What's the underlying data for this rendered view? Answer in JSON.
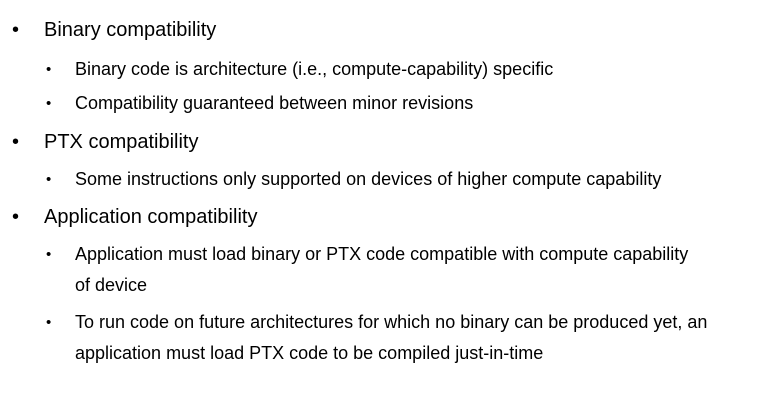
{
  "bullets": [
    {
      "text": "Binary compatibility",
      "sub": [
        "Binary code is architecture (i.e., compute-capability) specific",
        "Compatibility guaranteed between minor revisions"
      ]
    },
    {
      "text": "PTX compatibility",
      "sub": [
        "Some instructions only supported on devices of higher compute capability"
      ]
    },
    {
      "text": "Application compatibility",
      "sub": [
        "Application must load binary or PTX code compatible with compute capability of device",
        "To run code on future architectures for which no binary can be produced yet, an application must load PTX code to be compiled just-in-time"
      ]
    }
  ],
  "bullet_glyph": "•"
}
